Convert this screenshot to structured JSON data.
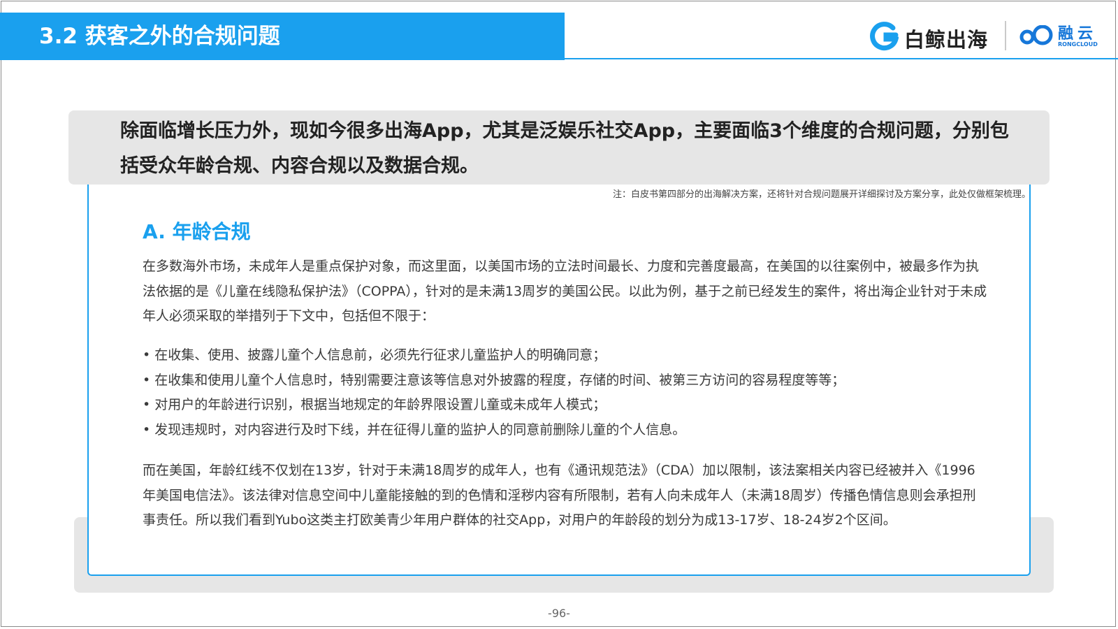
{
  "header": {
    "title": "3.2 获客之外的合规问题",
    "logo_baijing": "白鲸出海",
    "logo_rongcloud_cn": "融云",
    "logo_rongcloud_en": "RONGCLOUD",
    "accent_color": "#1aa0ee"
  },
  "intro": "除面临增长压力外，现如今很多出海App，尤其是泛娱乐社交App，主要面临3个维度的合规问题，分别包括受众年龄合规、内容合规以及数据合规。",
  "note": "注：白皮书第四部分的出海解决方案，还将针对合规问题展开详细探讨及方案分享，此处仅做框架梳理。",
  "section": {
    "heading": "A. 年龄合规",
    "paragraph_1": "在多数海外市场，未成年人是重点保护对象，而这里面，以美国市场的立法时间最长、力度和完善度最高，在美国的以往案例中，被最多作为执法依据的是《儿童在线隐私保护法》（COPPA），针对的是未满13周岁的美国公民。以此为例，基于之前已经发生的案件，将出海企业针对于未成年人必须采取的举措列于下文中，包括但不限于：",
    "bullets": [
      "在收集、使用、披露儿童个人信息前，必须先行征求儿童监护人的明确同意；",
      "在收集和使用儿童个人信息时，特别需要注意该等信息对外披露的程度，存储的时间、被第三方访问的容易程度等等；",
      "对用户的年龄进行识别，根据当地规定的年龄界限设置儿童或未成年人模式；",
      "发现违规时，对内容进行及时下线，并在征得儿童的监护人的同意前删除儿童的个人信息。"
    ],
    "paragraph_2": "而在美国，年龄红线不仅划在13岁，针对于未满18周岁的成年人，也有《通讯规范法》（CDA）加以限制，该法案相关内容已经被并入《1996年美国电信法》。该法律对信息空间中儿童能接触的到的色情和淫秽内容有所限制，若有人向未成年人（未满18周岁）传播色情信息则会承担刑事责任。所以我们看到Yubo这类主打欧美青少年用户群体的社交App，对用户的年龄段的划分为成13-17岁、18-24岁2个区间。"
  },
  "page_number": "-96-"
}
